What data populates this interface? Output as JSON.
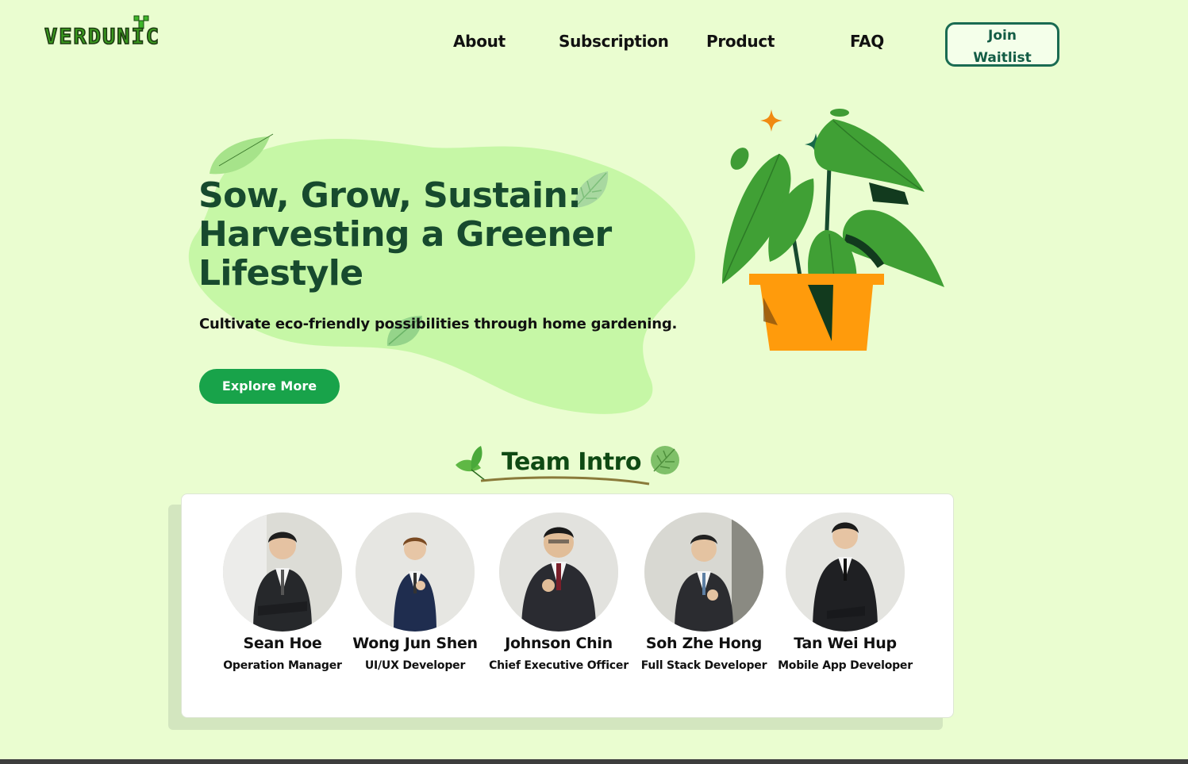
{
  "brand": {
    "logo_text": "VERDUNIC"
  },
  "nav": {
    "items": [
      "About",
      "Subscription",
      "Product",
      "FAQ"
    ],
    "join_label_line1": "Join",
    "join_label_line2": "Waitlist"
  },
  "hero": {
    "title_line1": "Sow, Grow, Sustain:",
    "title_line2": "Harvesting a Greener",
    "title_line3": "Lifestyle",
    "subtitle": "Cultivate eco-friendly possibilities through home gardening.",
    "cta_label": "Explore More"
  },
  "team": {
    "heading": "Team Intro",
    "members": [
      {
        "name": "Sean Hoe",
        "role": "Operation Manager"
      },
      {
        "name": "Wong Jun Shen",
        "role": "UI/UX Developer"
      },
      {
        "name": "Johnson Chin",
        "role": "Chief Executive Officer"
      },
      {
        "name": "Soh Zhe Hong",
        "role": "Full Stack Developer"
      },
      {
        "name": "Tan Wei Hup",
        "role": "Mobile App Developer"
      }
    ]
  },
  "colors": {
    "background": "#eafdd0",
    "accent_green": "#18a34a",
    "dark_green": "#174a2e",
    "blob": "#c6f7a6",
    "pot_orange": "#ff9b0c"
  },
  "icons": [
    "leaf-icon",
    "sparkle-icon",
    "plant-pot-illustration"
  ]
}
